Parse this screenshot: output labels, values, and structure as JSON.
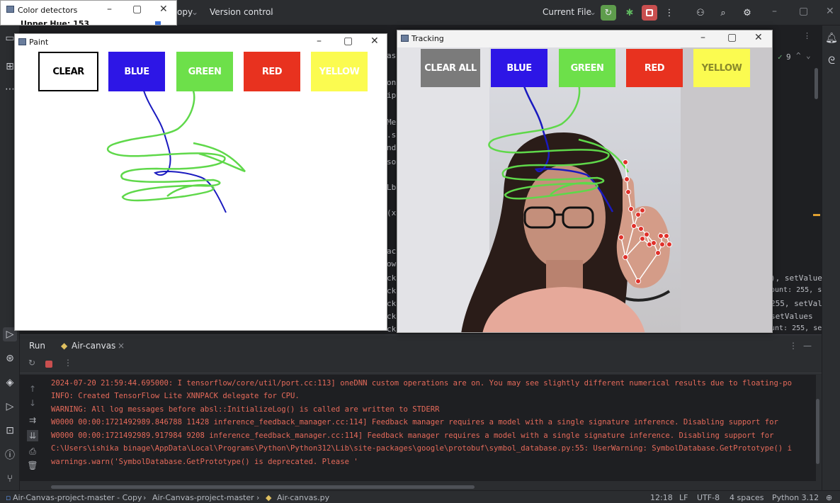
{
  "ide": {
    "menu_partial": "opy",
    "version_control": "Version control",
    "run_config": "Current File",
    "editor_fragments": [
      "as",
      "on",
      "ip",
      "Me",
      ".s",
      "nd",
      "so",
      "Lb",
      "(x",
      "ac",
      "ow",
      "ck",
      "ck",
      "ck",
      "ck",
      "ck"
    ],
    "right_fragments": [
      "), setValue",
      "ount: 255, s",
      "255, setVal",
      " setValues",
      "unt: 255, se"
    ],
    "inspection_count": "9"
  },
  "color_detectors": {
    "title": "Color detectors",
    "label_partial": "Upper Hue: 153"
  },
  "paint": {
    "title": "Paint",
    "buttons": [
      {
        "label": "CLEAR",
        "bg": "#ffffff",
        "fg": "#000000",
        "border": "#000000"
      },
      {
        "label": "BLUE",
        "bg": "#2d16e6",
        "fg": "#ffffff",
        "border": "#2d16e6"
      },
      {
        "label": "GREEN",
        "bg": "#6de04a",
        "fg": "#ffffff",
        "border": "#6de04a"
      },
      {
        "label": "RED",
        "bg": "#e8321f",
        "fg": "#ffffff",
        "border": "#e8321f"
      },
      {
        "label": "YELLOW",
        "bg": "#fbfb50",
        "fg": "#ffffff",
        "border": "#fbfb50"
      }
    ]
  },
  "tracking": {
    "title": "Tracking",
    "buttons": [
      {
        "label": "CLEAR ALL",
        "bg": "#7b7b7b",
        "fg": "#ffffff"
      },
      {
        "label": "BLUE",
        "bg": "#2d16e6",
        "fg": "#ffffff"
      },
      {
        "label": "GREEN",
        "bg": "#6de04a",
        "fg": "#ffffff"
      },
      {
        "label": "RED",
        "bg": "#e8321f",
        "fg": "#ffffff"
      },
      {
        "label": "YELLOW",
        "bg": "#fbfb50",
        "fg": "#8a8a2a"
      }
    ]
  },
  "run_panel": {
    "run_tab": "Run",
    "config_tab": "Air-canvas",
    "console_lines": [
      "2024-07-20 21:59:44.695000: I tensorflow/core/util/port.cc:113] oneDNN custom operations are on. You may see slightly different numerical results due to floating-po",
      "INFO: Created TensorFlow Lite XNNPACK delegate for CPU.",
      "WARNING: All log messages before absl::InitializeLog() is called are written to STDERR",
      "W0000 00:00:1721492989.846788   11428 inference_feedback_manager.cc:114] Feedback manager requires a model with a single signature inference. Disabling support for",
      "W0000 00:00:1721492989.917984    9208 inference_feedback_manager.cc:114] Feedback manager requires a model with a single signature inference. Disabling support for",
      "C:\\Users\\ishika binage\\AppData\\Local\\Programs\\Python\\Python312\\Lib\\site-packages\\google\\protobuf\\symbol_database.py:55: UserWarning: SymbolDatabase.GetPrototype() i",
      "  warnings.warn('SymbolDatabase.GetPrototype() is deprecated. Please '"
    ]
  },
  "status": {
    "breadcrumb": [
      "Air-Canvas-project-master - Copy",
      "Air-Canvas-project-master",
      "Air-canvas.py"
    ],
    "position": "12:18",
    "line_ending": "LF",
    "encoding": "UTF-8",
    "indent": "4 spaces",
    "interpreter": "Python 3.12"
  }
}
